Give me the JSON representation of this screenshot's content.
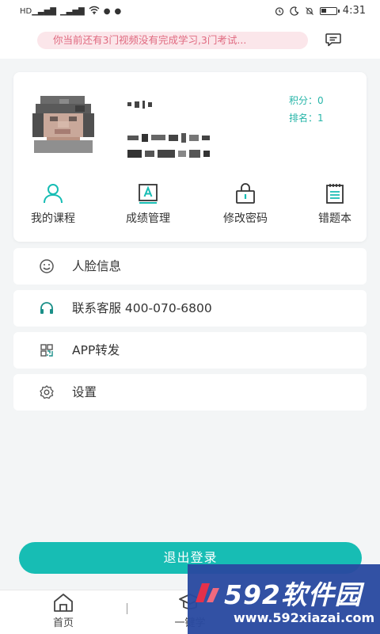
{
  "status_bar": {
    "time": "4:31",
    "network_1": "4G",
    "network_2": "4G"
  },
  "notice": {
    "text": "你当前还有3门视频没有完成学习,3门考试..."
  },
  "profile": {
    "points_label": "积分：0",
    "rank_label": "排名：1"
  },
  "quick_actions": [
    {
      "label": "我的课程",
      "icon": "person-icon"
    },
    {
      "label": "成绩管理",
      "icon": "grade-icon"
    },
    {
      "label": "修改密码",
      "icon": "lock-icon"
    },
    {
      "label": "错题本",
      "icon": "notebook-icon"
    }
  ],
  "menu": [
    {
      "label": "人脸信息",
      "icon": "smile-icon"
    },
    {
      "label": "联系客服 400-070-6800",
      "icon": "headset-icon"
    },
    {
      "label": "APP转发",
      "icon": "qrcode-icon"
    },
    {
      "label": "设置",
      "icon": "gear-icon"
    }
  ],
  "logout": {
    "label": "退出登录"
  },
  "bottom_nav": [
    {
      "label": "首页",
      "icon": "home-icon"
    },
    {
      "label": "一键学",
      "icon": "graduation-cap-icon"
    }
  ],
  "watermark": {
    "brand": "592软件园",
    "url": "www.592xiazai.com"
  },
  "colors": {
    "accent": "#17bdb4",
    "notice_bg": "#fbe6ea",
    "notice_text": "#e06a80",
    "stats_text": "#26b5a8"
  }
}
